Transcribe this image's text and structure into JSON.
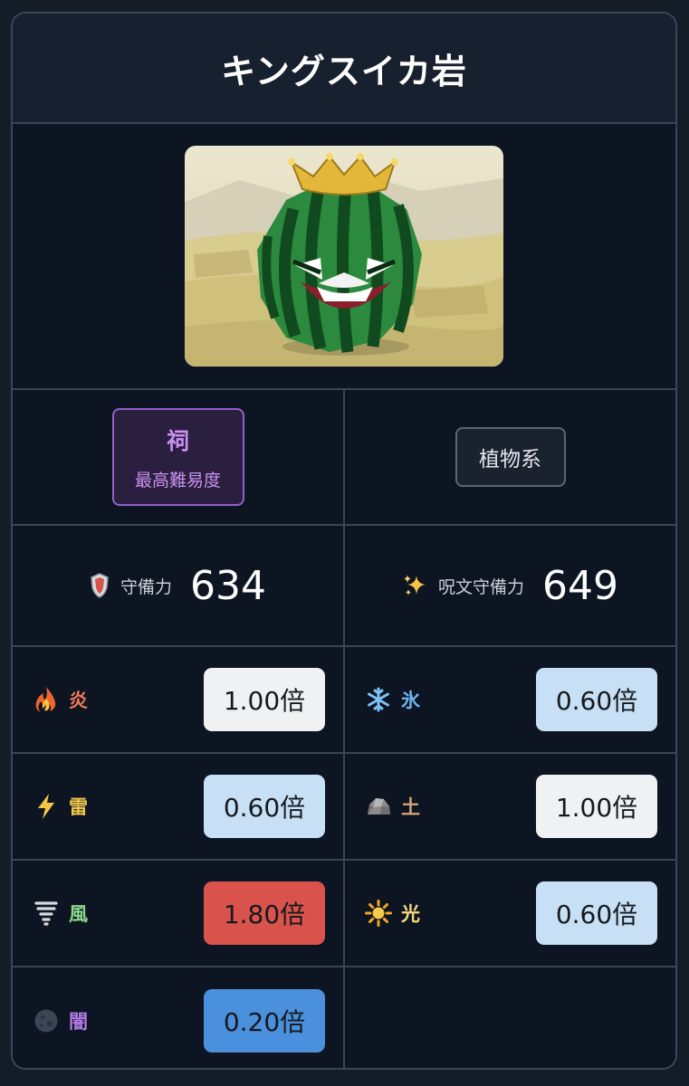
{
  "monster": {
    "name": "キングスイカ岩"
  },
  "difficulty": {
    "label": "祠",
    "sub": "最高難易度"
  },
  "type": {
    "label": "植物系"
  },
  "defense": {
    "physical_label": "守備力",
    "physical_value": "634",
    "spell_label": "呪文守備力",
    "spell_value": "649"
  },
  "elements": [
    {
      "name": "炎",
      "multiplier": "1.00倍",
      "color": "#f07a5a",
      "icon": "fire-icon",
      "level": "neutral"
    },
    {
      "name": "氷",
      "multiplier": "0.60倍",
      "color": "#6cb6f0",
      "icon": "snowflake-icon",
      "level": "resist"
    },
    {
      "name": "雷",
      "multiplier": "0.60倍",
      "color": "#f0c84a",
      "icon": "lightning-icon",
      "level": "resist"
    },
    {
      "name": "土",
      "multiplier": "1.00倍",
      "color": "#d8a77a",
      "icon": "rock-icon",
      "level": "neutral"
    },
    {
      "name": "風",
      "multiplier": "1.80倍",
      "color": "#8cd68c",
      "icon": "tornado-icon",
      "level": "weak"
    },
    {
      "name": "光",
      "multiplier": "0.60倍",
      "color": "#f5d97a",
      "icon": "sun-icon",
      "level": "resist"
    },
    {
      "name": "闇",
      "multiplier": "0.20倍",
      "color": "#b27be6",
      "icon": "dark-moon-icon",
      "level": "strong-resist"
    }
  ]
}
